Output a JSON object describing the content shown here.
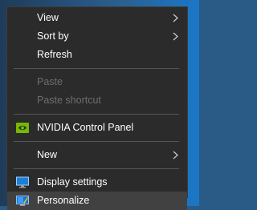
{
  "menu": {
    "items": [
      {
        "label": "View"
      },
      {
        "label": "Sort by"
      },
      {
        "label": "Refresh"
      },
      {
        "label": "Paste"
      },
      {
        "label": "Paste shortcut"
      },
      {
        "label": "NVIDIA Control Panel",
        "icon": "nvidia-icon"
      },
      {
        "label": "New"
      },
      {
        "label": "Display settings",
        "icon": "display-icon"
      },
      {
        "label": "Personalize",
        "icon": "personalize-icon"
      }
    ]
  },
  "colors": {
    "menu_background": "#2b2b2b",
    "text": "#ffffff",
    "disabled_text": "#6e6e6e",
    "highlight": "#414141",
    "nvidia_green": "#76b900"
  }
}
